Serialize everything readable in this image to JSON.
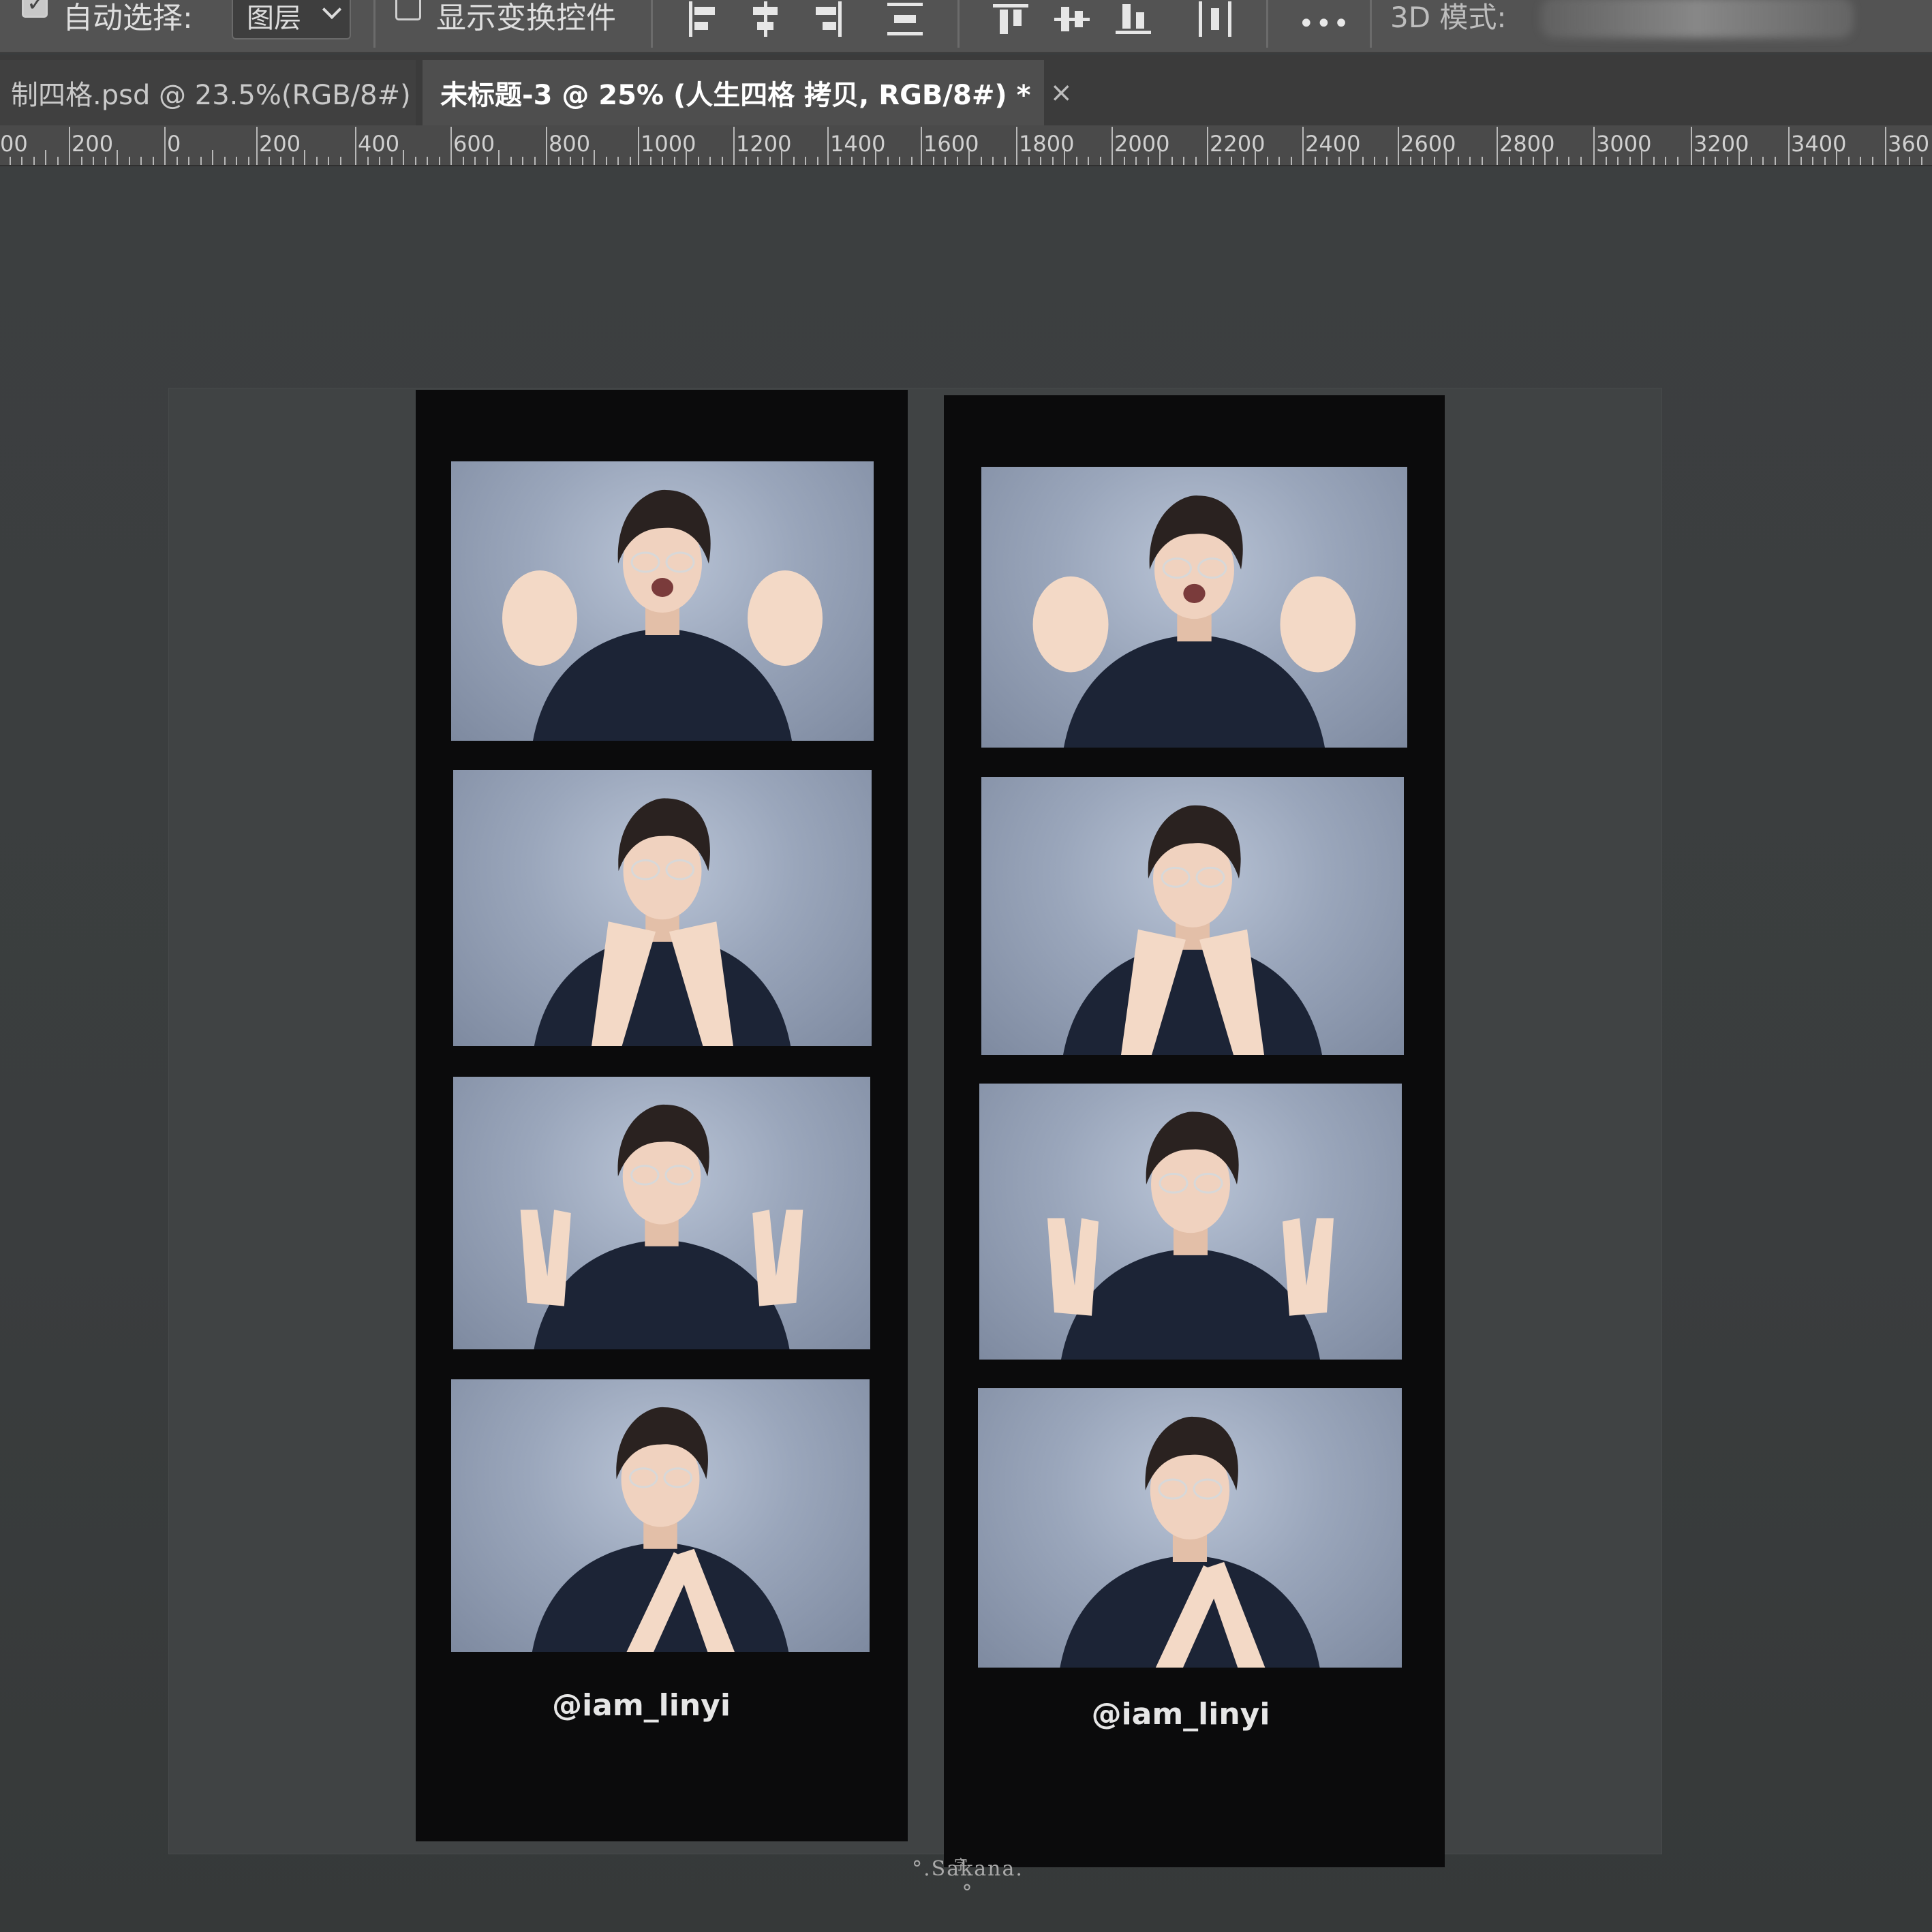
{
  "options_bar": {
    "auto_select_label": "自动选择:",
    "auto_select_value": "图层",
    "show_transform_label": "显示变换控件",
    "more_label": "•••",
    "mode_label": "3D 模式:",
    "icons": [
      "align-left-icon",
      "align-hcenter-icon",
      "align-right-icon",
      "distribute-vertical-icon",
      "align-top-icon",
      "align-vcenter-icon",
      "align-bottom-icon",
      "distribute-horizontal-icon"
    ]
  },
  "tabs": [
    {
      "label": "制四格.psd @ 23.5%(RGB/8#)",
      "close": "×",
      "active": false
    },
    {
      "label": "未标题-3 @ 25% (人生四格 拷贝, RGB/8#) *",
      "close": "×",
      "active": true
    }
  ],
  "ruler": {
    "labels": [
      "00",
      "200",
      "0",
      "200",
      "400",
      "600",
      "800",
      "1000",
      "1200",
      "1400",
      "1600",
      "1800",
      "2000",
      "2200",
      "2400",
      "2600",
      "2800",
      "3000",
      "3200",
      "3400",
      "360"
    ]
  },
  "canvas": {
    "strips": [
      {
        "handle": "@iam_linyi",
        "poses": [
          "claws",
          "chin-rest",
          "peace",
          "hands-cross"
        ]
      },
      {
        "handle": "@iam_linyi",
        "poses": [
          "claws",
          "chin-rest",
          "peace",
          "hands-cross"
        ]
      }
    ]
  },
  "watermark": {
    "text": "°.Sakana.°",
    "mark": "字"
  },
  "colors": {
    "options_bar_bg": "#535353",
    "tab_active_bg": "#4e4e4e",
    "workspace_bg": "#3a3d3e",
    "strip_bg": "#0b0b0c",
    "photo_bg": "#9aa6bb"
  }
}
